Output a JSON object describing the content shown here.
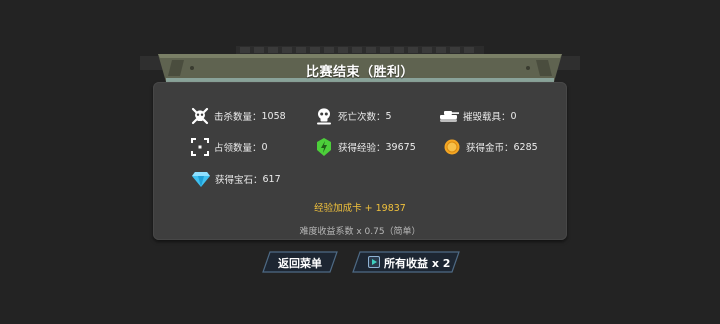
{
  "header": {
    "title": "比赛结束（胜利）"
  },
  "stats": [
    {
      "icon": "skull-crossbones-icon",
      "label": "击杀数量：",
      "value": "1058"
    },
    {
      "icon": "skull-icon",
      "label": "死亡次数：",
      "value": "5"
    },
    {
      "icon": "tank-icon",
      "label": "摧毁载具：",
      "value": "0"
    },
    {
      "icon": "capture-zone-icon",
      "label": "占领数量：",
      "value": "0"
    },
    {
      "icon": "experience-icon",
      "label": "获得经验：",
      "value": "39675"
    },
    {
      "icon": "gold-coin-icon",
      "label": "获得金币：",
      "value": "6285"
    },
    {
      "icon": "diamond-icon",
      "label": "获得宝石：",
      "value": "617"
    }
  ],
  "bonus_text": "经验加成卡 + 19837",
  "difficulty_text": "难度收益系数 x 0.75（简单）",
  "buttons": {
    "return_menu": "返回菜单",
    "all_rewards": "所有收益 x 2"
  },
  "colors": {
    "background": "#232323",
    "panel": "#3e3e3e",
    "bonus": "#f0c13c",
    "experience": "#4ccf3a",
    "gold": "#f5a623",
    "diamond": "#3fc1f0"
  }
}
